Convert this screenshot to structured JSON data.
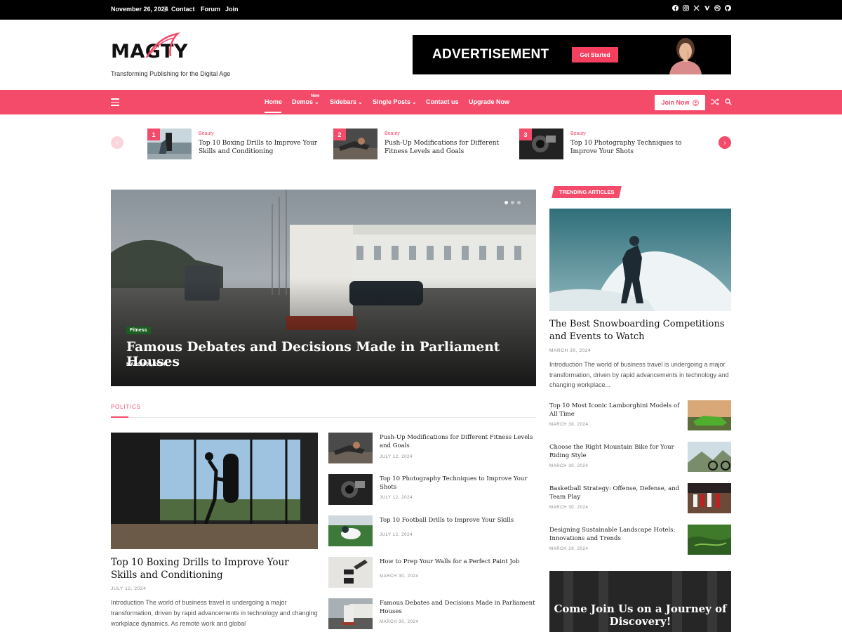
{
  "topbar": {
    "date": "November 26, 2024",
    "separator": "|",
    "links": [
      "Contact",
      "Forum",
      "Join"
    ],
    "social_icons": [
      "facebook-icon",
      "instagram-icon",
      "x-icon",
      "vimeo-icon",
      "dribbble-icon",
      "github-icon"
    ]
  },
  "header": {
    "logo": "MAGTY",
    "tagline": "Transforming Publishing for the Digital Age",
    "ad": {
      "text": "ADVERTISEMENT",
      "button": "Get Started"
    }
  },
  "nav": {
    "items": [
      {
        "label": "Home",
        "dropdown": false
      },
      {
        "label": "Demos",
        "dropdown": true
      },
      {
        "label": "Sidebars",
        "dropdown": true
      },
      {
        "label": "Single Posts",
        "dropdown": true
      },
      {
        "label": "Contact us",
        "dropdown": false
      },
      {
        "label": "Upgrade Now",
        "dropdown": false
      }
    ],
    "new_badge": "New",
    "join_button": "Join Now",
    "accent_color": "#f44b6a"
  },
  "ticker": [
    {
      "num": "1",
      "category": "Beauty",
      "title": "Top 10 Boxing Drills to Improve Your Skills and Conditioning"
    },
    {
      "num": "2",
      "category": "Beauty",
      "title": "Push-Up Modifications for Different Fitness Levels and Goals"
    },
    {
      "num": "3",
      "category": "Beauty",
      "title": "Top 10 Photography Techniques to Improve Your Shots"
    }
  ],
  "hero": {
    "category": "Fitness",
    "title": "Famous Debates and Decisions Made in Parliament Houses",
    "date": "MARCH 30, 2024"
  },
  "politics": {
    "label": "POLITICS",
    "featured": {
      "title": "Top 10 Boxing Drills to Improve Your Skills and Conditioning",
      "date": "JULY 12, 2024",
      "excerpt": "Introduction The world of business travel is undergoing a major transformation, driven by rapid advancements in technology and changing workplace dynamics. As remote work and global"
    },
    "list": [
      {
        "title": "Push-Up Modifications for Different Fitness Levels and Goals",
        "date": "JULY 12, 2024"
      },
      {
        "title": "Top 10 Photography Techniques to Improve Your Shots",
        "date": "JULY 12, 2024"
      },
      {
        "title": "Top 10 Football Drills to Improve Your Skills",
        "date": "JULY 12, 2024"
      },
      {
        "title": "How to Prep Your Walls for a Perfect Paint Job",
        "date": "MARCH 30, 2024"
      },
      {
        "title": "Famous Debates and Decisions Made in Parliament Houses",
        "date": "MARCH 30, 2024"
      }
    ]
  },
  "sidebar": {
    "tag": "TRENDING ARTICLES",
    "featured": {
      "title": "The Best Snowboarding Competitions and Events to Watch",
      "date": "MARCH 30, 2024",
      "excerpt": "Introduction The world of business travel is undergoing a major transformation, driven by rapid advancements in technology and changing workplace..."
    },
    "list": [
      {
        "title": "Top 10 Most Iconic Lamborghini Models of All Time",
        "date": "MARCH 30, 2024"
      },
      {
        "title": "Choose the Right Mountain Bike for Your Riding Style",
        "date": "MARCH 30, 2024"
      },
      {
        "title": "Basketball Strategy: Offense, Defense, and Team Play",
        "date": "MARCH 30, 2024"
      },
      {
        "title": "Designing Sustainable Landscape Hotels: Innovations and Trends",
        "date": "MARCH 29, 2024"
      }
    ],
    "promo": "Come Join Us on a Journey of Discovery!"
  }
}
